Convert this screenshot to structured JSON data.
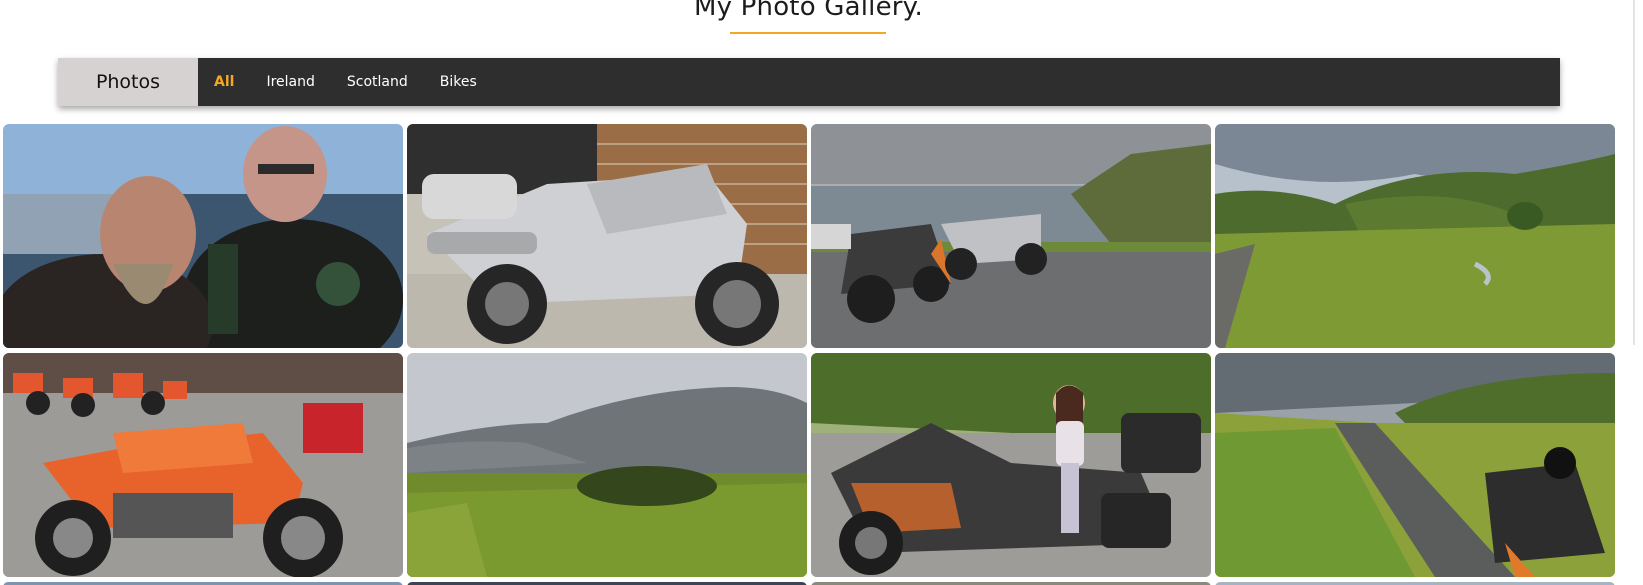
{
  "page": {
    "title": "My Photo Gallery."
  },
  "nav": {
    "brand": "Photos",
    "filters": [
      "All",
      "Ireland",
      "Scotland",
      "Bikes"
    ],
    "active_filter": "All"
  },
  "gallery": {
    "photos": [
      {
        "subject": "two-riders-selfie-by-sea"
      },
      {
        "subject": "silver-sport-motorcycle-garage"
      },
      {
        "subject": "motorcycles-coastal-road"
      },
      {
        "subject": "green-valley-road"
      },
      {
        "subject": "orange-adventure-bikes-dealership"
      },
      {
        "subject": "mountains-and-moorland"
      },
      {
        "subject": "child-on-motorcycle"
      },
      {
        "subject": "motorcycle-by-mountain-road"
      },
      {
        "subject": "partial-row-photo"
      },
      {
        "subject": "partial-row-photo"
      },
      {
        "subject": "partial-row-photo"
      },
      {
        "subject": "partial-row-photo"
      }
    ]
  },
  "colors": {
    "accent": "#f5a623",
    "navbar_bg": "#2e2e2e",
    "brand_bg": "#d6d2d2"
  }
}
